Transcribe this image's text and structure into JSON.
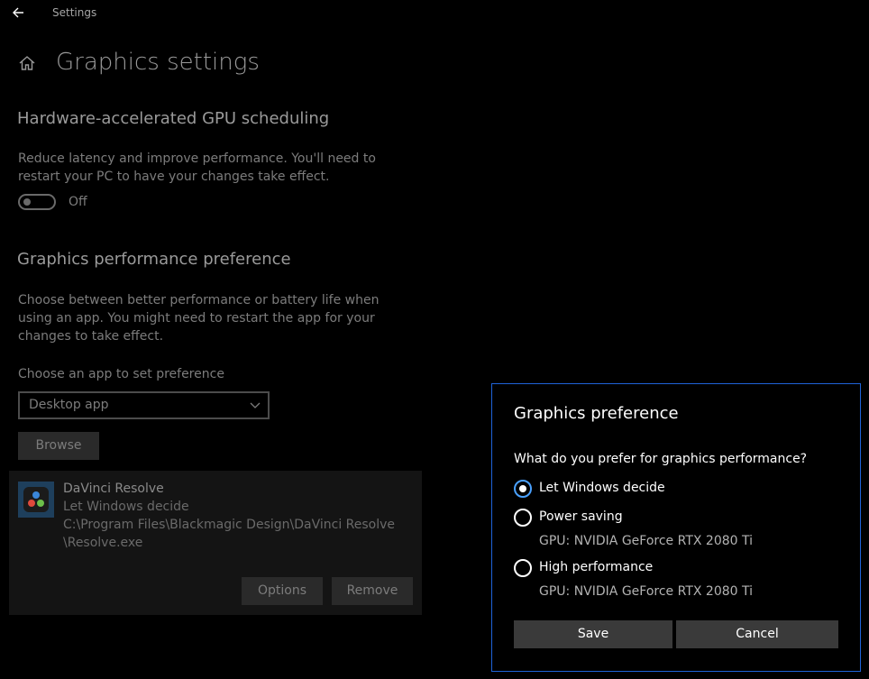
{
  "window": {
    "title": "Settings"
  },
  "page": {
    "title": "Graphics settings"
  },
  "gpu_scheduling": {
    "title": "Hardware-accelerated GPU scheduling",
    "description": "Reduce latency and improve performance. You'll need to restart your PC to have your changes take effect.",
    "toggle_state": "Off"
  },
  "performance": {
    "title": "Graphics performance preference",
    "description": "Choose between better performance or battery life when using an app. You might need to restart the app for your changes to take effect.",
    "choose_label": "Choose an app to set preference",
    "select_value": "Desktop app",
    "browse_label": "Browse"
  },
  "app_item": {
    "name": "DaVinci Resolve",
    "preference": "Let Windows decide",
    "path_line1": "C:\\Program Files\\Blackmagic Design\\DaVinci Resolve",
    "path_line2": "\\Resolve.exe",
    "options_label": "Options",
    "remove_label": "Remove"
  },
  "dialog": {
    "title": "Graphics preference",
    "question": "What do you prefer for graphics performance?",
    "options": [
      {
        "label": "Let Windows decide",
        "selected": true,
        "gpu": ""
      },
      {
        "label": "Power saving",
        "selected": false,
        "gpu": "GPU: NVIDIA GeForce RTX 2080 Ti"
      },
      {
        "label": "High performance",
        "selected": false,
        "gpu": "GPU: NVIDIA GeForce RTX 2080 Ti"
      }
    ],
    "save_label": "Save",
    "cancel_label": "Cancel"
  },
  "icons": {
    "back": "back-arrow-icon",
    "home": "home-icon",
    "chevron": "chevron-down-icon",
    "app": "davinci-resolve-icon"
  },
  "colors": {
    "background": "#000000",
    "accent": "#1f63d8",
    "radio_accent": "#4aa1ff"
  }
}
